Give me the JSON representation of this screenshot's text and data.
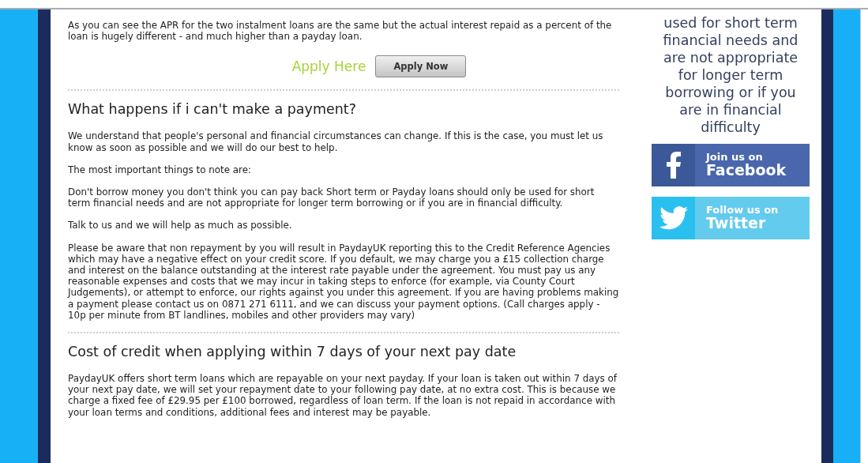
{
  "intro": "As you can see the APR for the two instalment loans are the same but the actual interest repaid as a percent of the loan is hugely different - and much higher than a payday loan.",
  "apply": {
    "label": "Apply Here",
    "button": "Apply Now"
  },
  "sections": [
    {
      "heading": "What happens if i can't make a payment?",
      "paragraphs": [
        "We understand that people's personal and financial circumstances can change. If this is the case, you must let us know as soon as possible and we will do our best to help.",
        "The most important things to note are:",
        "Don't borrow money you don't think you can pay back  Short term or Payday loans should only be used for short term financial needs and are not appropriate for longer term borrowing or if you are in financial difficulty.",
        "Talk to us and we will help as much as possible.",
        "Please be aware that non repayment by you will result in PaydayUK reporting this to the Credit Reference Agencies which may have a negative effect on your credit score. If you default, we may charge you a £15 collection charge and interest on the balance outstanding at the interest rate payable under the agreement. You must pay us any reasonable expenses and costs that we may incur in taking steps to enforce (for example, via County Court Judgements), or attempt to enforce, our rights against you under this agreement. If you are having problems making a payment please contact us on 0871 271 6111, and we can discuss your payment options. (Call charges apply - 10p per minute from BT landlines, mobiles and other providers may vary)"
      ]
    },
    {
      "heading": "Cost of credit when applying within 7 days of your next pay date",
      "paragraphs": [
        "PaydayUK offers short term loans which are repayable on your next payday. If your loan is taken out within 7 days of your next pay date, we will set your repayment date to your following pay date, at no extra cost. This is because we charge a fixed fee of £29.95 per £100 borrowed, regardless of loan term. If the loan is not repaid in accordance with your loan terms and conditions, additional fees and interest may be payable."
      ]
    }
  ],
  "sidebar": {
    "notice_lines": [
      "used for short term",
      "financial needs and",
      "are not appropriate",
      "for longer term",
      "borrowing or if you",
      "are in financial",
      "difficulty"
    ],
    "social": [
      {
        "kind": "facebook",
        "small": "Join us on",
        "big": "Facebook"
      },
      {
        "kind": "twitter",
        "small": "Follow us on",
        "big": "Twitter"
      }
    ]
  }
}
